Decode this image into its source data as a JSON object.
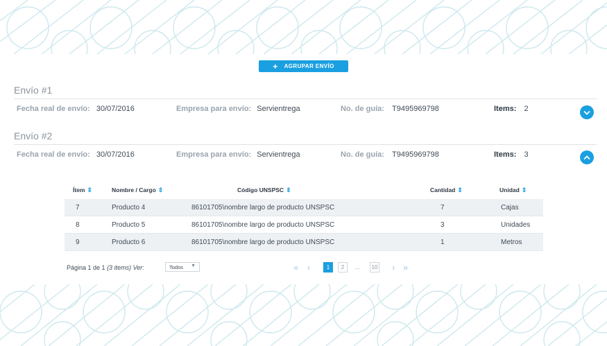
{
  "toolbar": {
    "group_plus": "+",
    "group_label": "AGRUPAR ENVÍO"
  },
  "labels": {
    "fecha": "Fecha real de envío:",
    "empresa": "Empresa para envío:",
    "guia": "No. de guía:",
    "items": "Items:"
  },
  "shipments": [
    {
      "title": "Envío #1",
      "fecha": "30/07/2016",
      "empresa": "Servientrega",
      "guia": "T9495969798",
      "items": "2",
      "expanded": false
    },
    {
      "title": "Envío #2",
      "fecha": "30/07/2016",
      "empresa": "Servientrega",
      "guia": "T9495969798",
      "items": "3",
      "expanded": true
    }
  ],
  "table": {
    "columns": [
      "Ítem",
      "Nombre / Cargo",
      "Código UNSPSC",
      "Cantidad",
      "Unidad"
    ],
    "rows": [
      [
        "7",
        "Producto 4",
        "86101705\\nombre largo de producto UNSPSC",
        "7",
        "Cajas"
      ],
      [
        "8",
        "Producto 5",
        "86101705\\nombre largo de producto UNSPSC",
        "3",
        "Unidades"
      ],
      [
        "9",
        "Producto 6",
        "86101705\\nombre largo de producto UNSPSC",
        "1",
        "Metros"
      ]
    ]
  },
  "pager": {
    "page_prefix": "Página 1 de 1",
    "items_info": "(3 items)",
    "ver_label": "Ver:",
    "ver_value": "Todos",
    "pages": [
      "1",
      "2",
      "10"
    ],
    "ellipsis": "...",
    "first": "«",
    "prev": "‹",
    "next": "›",
    "last": "»"
  },
  "colors": {
    "accent": "#1a9fe0",
    "pattern_stroke": "#cfe9ef"
  },
  "icons": {
    "expand": "chevron-down-icon",
    "collapse": "chevron-up-icon",
    "sort": "sort-icon"
  }
}
